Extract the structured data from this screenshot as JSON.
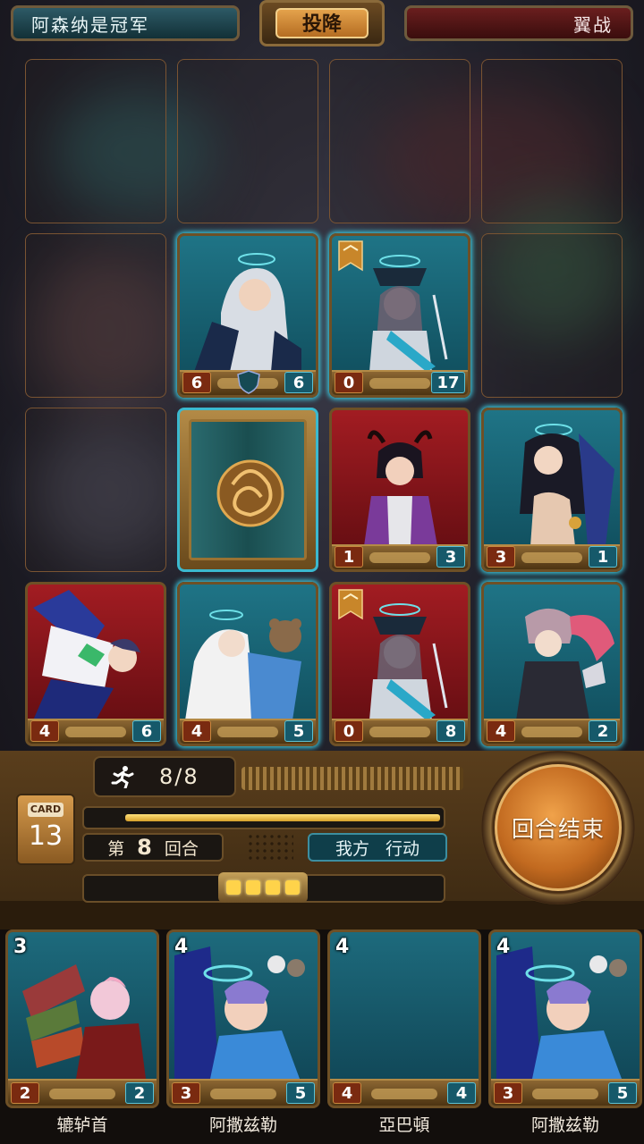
{
  "topbar": {
    "player_name": "阿森纳是冠军",
    "surrender_label": "投降",
    "opponent_name": "翼战"
  },
  "board": {
    "cards": [
      {
        "id": "r2c2",
        "frame": "blue",
        "atk": "6",
        "hp": "6",
        "shield": true,
        "banner": false
      },
      {
        "id": "r2c3",
        "frame": "blue",
        "atk": "0",
        "hp": "17",
        "shield": false,
        "banner": true
      },
      {
        "id": "r3c3",
        "frame": "red",
        "atk": "1",
        "hp": "3",
        "shield": false,
        "banner": false
      },
      {
        "id": "r3c4",
        "frame": "blue",
        "atk": "3",
        "hp": "1",
        "shield": false,
        "banner": false
      },
      {
        "id": "r4c1",
        "frame": "red",
        "atk": "4",
        "hp": "6",
        "shield": false,
        "banner": false
      },
      {
        "id": "r4c2",
        "frame": "blue",
        "atk": "4",
        "hp": "5",
        "shield": false,
        "banner": false
      },
      {
        "id": "r4c3",
        "frame": "red",
        "atk": "0",
        "hp": "8",
        "shield": false,
        "banner": true
      },
      {
        "id": "r4c4",
        "frame": "blue",
        "atk": "4",
        "hp": "2",
        "shield": false,
        "banner": false
      }
    ]
  },
  "panel": {
    "moves": "8/8",
    "card_label": "CARD",
    "card_count": "13",
    "round_prefix": "第",
    "round_number": "8",
    "round_suffix": "回合",
    "phase_side": "我方",
    "phase_action": "行动",
    "energy": 4,
    "end_turn_label": "回合结束"
  },
  "hand": [
    {
      "cost": "3",
      "atk": "2",
      "hp": "2",
      "name": "辘轳首"
    },
    {
      "cost": "4",
      "atk": "3",
      "hp": "5",
      "name": "阿撒兹勒"
    },
    {
      "cost": "4",
      "atk": "4",
      "hp": "4",
      "name": "亞巴頓"
    },
    {
      "cost": "4",
      "atk": "3",
      "hp": "5",
      "name": "阿撒兹勒"
    }
  ],
  "colors": {
    "blue_frame_glow": "#3cc7dd",
    "red_frame": "#a21c22",
    "energy_pip": "#ffd34a",
    "end_turn": "#c26a20"
  }
}
